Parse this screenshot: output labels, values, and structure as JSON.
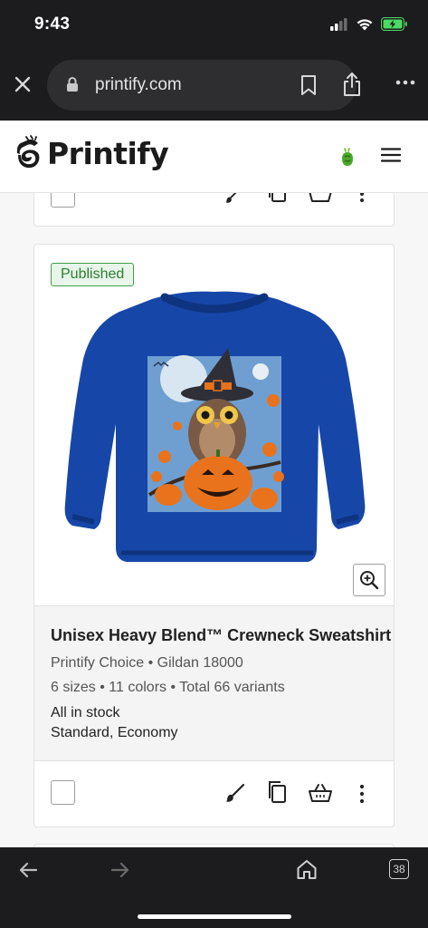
{
  "status_bar": {
    "time": "9:43"
  },
  "browser": {
    "url": "printify.com",
    "tab_count": "38"
  },
  "app": {
    "logo_text": "Printify"
  },
  "product": {
    "badge": "Published",
    "title": "Unisex Heavy Blend™ Crewneck Sweatshirt",
    "provider_line": "Printify Choice • Gildan 18000",
    "variants_line": "6 sizes • 11 colors • Total 66 variants",
    "stock": "All in stock",
    "shipping": "Standard, Economy"
  },
  "colors": {
    "chrome_bg": "#1c1c1e",
    "badge_green": "#2e7d32",
    "sweatshirt_blue": "#1646a8",
    "pumpkin_orange": "#e8731c"
  },
  "icons": [
    "close-icon",
    "lock-icon",
    "bookmark-icon",
    "share-icon",
    "more-icon",
    "printify-logo-icon",
    "notification-icon",
    "menu-icon",
    "zoom-in-icon",
    "brush-icon",
    "copy-icon",
    "basket-icon",
    "kebab-icon",
    "back-icon",
    "forward-icon",
    "home-icon",
    "tabs-icon"
  ]
}
